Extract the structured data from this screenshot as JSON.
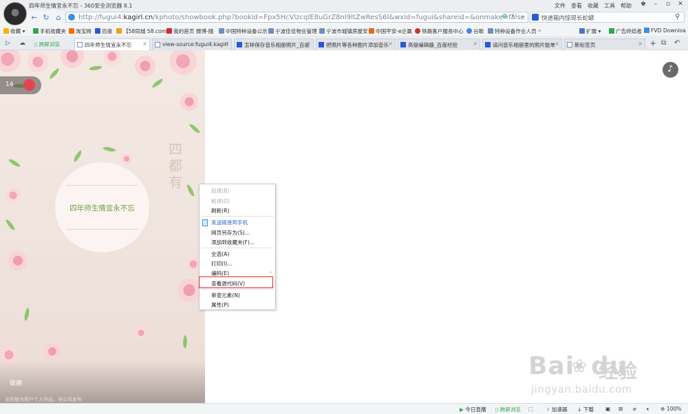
{
  "window": {
    "title": "四年师生情宜永不忘 - 360安全浏览器 8.1",
    "menus": [
      "文件",
      "查看",
      "收藏",
      "工具",
      "帮助"
    ]
  },
  "address_bar": {
    "url_prefix": "http://fugui4.",
    "url_domain": "kagirl.cn",
    "url_rest": "/kphoto/showbook.php?bookid=Fpx5HcVlzcqIE8uGrZ8nI9ltZwResS6I&wxid=fugui&shareid=&onmake=false"
  },
  "search": {
    "placeholder": "快递箱内惊现长蛇蟒"
  },
  "bookmarks": [
    {
      "label": "收藏",
      "color": "#f5b400"
    },
    {
      "label": "手机收藏夹",
      "color": "#2fa84f"
    },
    {
      "label": "淘宝网",
      "color": "#ff6a00"
    },
    {
      "label": "百度",
      "color": "#2b58d6"
    },
    {
      "label": "【58同城 58.com",
      "color": "#f0a020"
    },
    {
      "label": "我的首页 微博-随",
      "color": "#d52c2c"
    },
    {
      "label": "中国特种设备公示",
      "color": "#6f8fbf"
    },
    {
      "label": "宁波佳佳物业管理",
      "color": "#6f8fbf"
    },
    {
      "label": "宁波市城镇房屋安",
      "color": "#6f8fbf"
    },
    {
      "label": "中国平安-e企赢",
      "color": "#e56b1f"
    },
    {
      "label": "铁路客户服务中心",
      "color": "#c8372d"
    },
    {
      "label": "谷歌",
      "color": "#4285f4"
    },
    {
      "label": "特种设备作业人员",
      "color": "#6f8fbf"
    }
  ],
  "bookmarks_right": [
    "扩展",
    "广告终结者",
    "FVD Downloa"
  ],
  "tabs": [
    {
      "label": "四年师生情宜永不忘",
      "active": true
    },
    {
      "label": "view-source:fugui4.kagirl",
      "active": false
    },
    {
      "label": "怎样保存音乐相册照片_百度",
      "active": false
    },
    {
      "label": "把照片等各种图片添加音乐",
      "active": false
    },
    {
      "label": "高级编辑器_百度经验",
      "active": false
    },
    {
      "label": "请问音乐相册里的照片能单",
      "active": false
    },
    {
      "label": "新标签页",
      "active": false
    }
  ],
  "tab_prefix": "跨屏浏览",
  "page": {
    "counter": "14",
    "title": "四年师生情宜永不忘",
    "seal": "四 都 有",
    "author": "侯德",
    "footnote": "该相册为用户个人作品，非公司发布"
  },
  "context_menu": {
    "items": [
      {
        "label": "后退(B)",
        "disabled": true
      },
      {
        "label": "前进(O)",
        "disabled": true
      },
      {
        "label": "刷新(R)"
      },
      {
        "label": "发送链接到手机",
        "link": true
      },
      {
        "label": "网页另存为(S)..."
      },
      {
        "label": "添加到收藏夹(F)..."
      },
      {
        "label": "全选(A)"
      },
      {
        "label": "打印(I)..."
      },
      {
        "label": "编码(E)"
      },
      {
        "label": "查看源代码(V)",
        "highlighted": true
      },
      {
        "label": "审查元素(N)"
      },
      {
        "label": "属性(P)"
      }
    ]
  },
  "status_bar": [
    "今日直播",
    "跨屏浏览",
    "加速器",
    "下载",
    "100%"
  ],
  "watermark": {
    "logo": "Bai",
    "logo2": "du",
    "cn": "经验",
    "url": "jingyan.baidu.com"
  },
  "colors": {
    "highlight": "#e0262b",
    "link": "#2a66c9",
    "accent": "#4a74c9"
  }
}
